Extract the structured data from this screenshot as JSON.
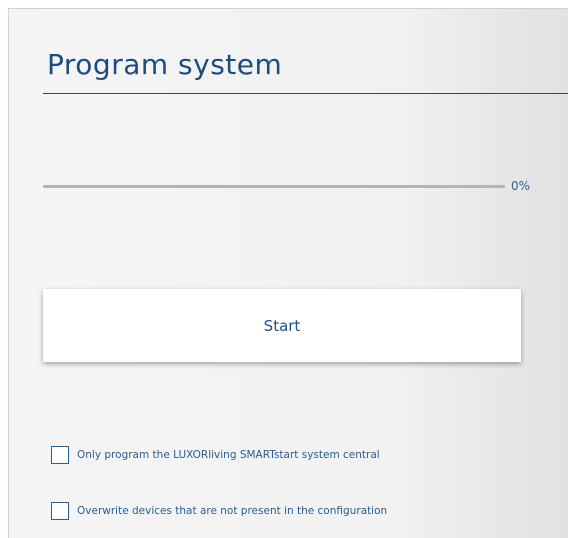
{
  "page": {
    "title": "Program system"
  },
  "progress": {
    "value": 0,
    "label": "0%"
  },
  "actions": {
    "start_label": "Start"
  },
  "options": [
    {
      "label": "Only program the LUXORliving SMARTstart system central",
      "checked": false
    },
    {
      "label": "Overwrite devices that are not present in the configuration",
      "checked": false
    }
  ],
  "colors": {
    "accent": "#1e4c7e",
    "track": "#b4b4b4",
    "background": "#f2f2f2"
  }
}
